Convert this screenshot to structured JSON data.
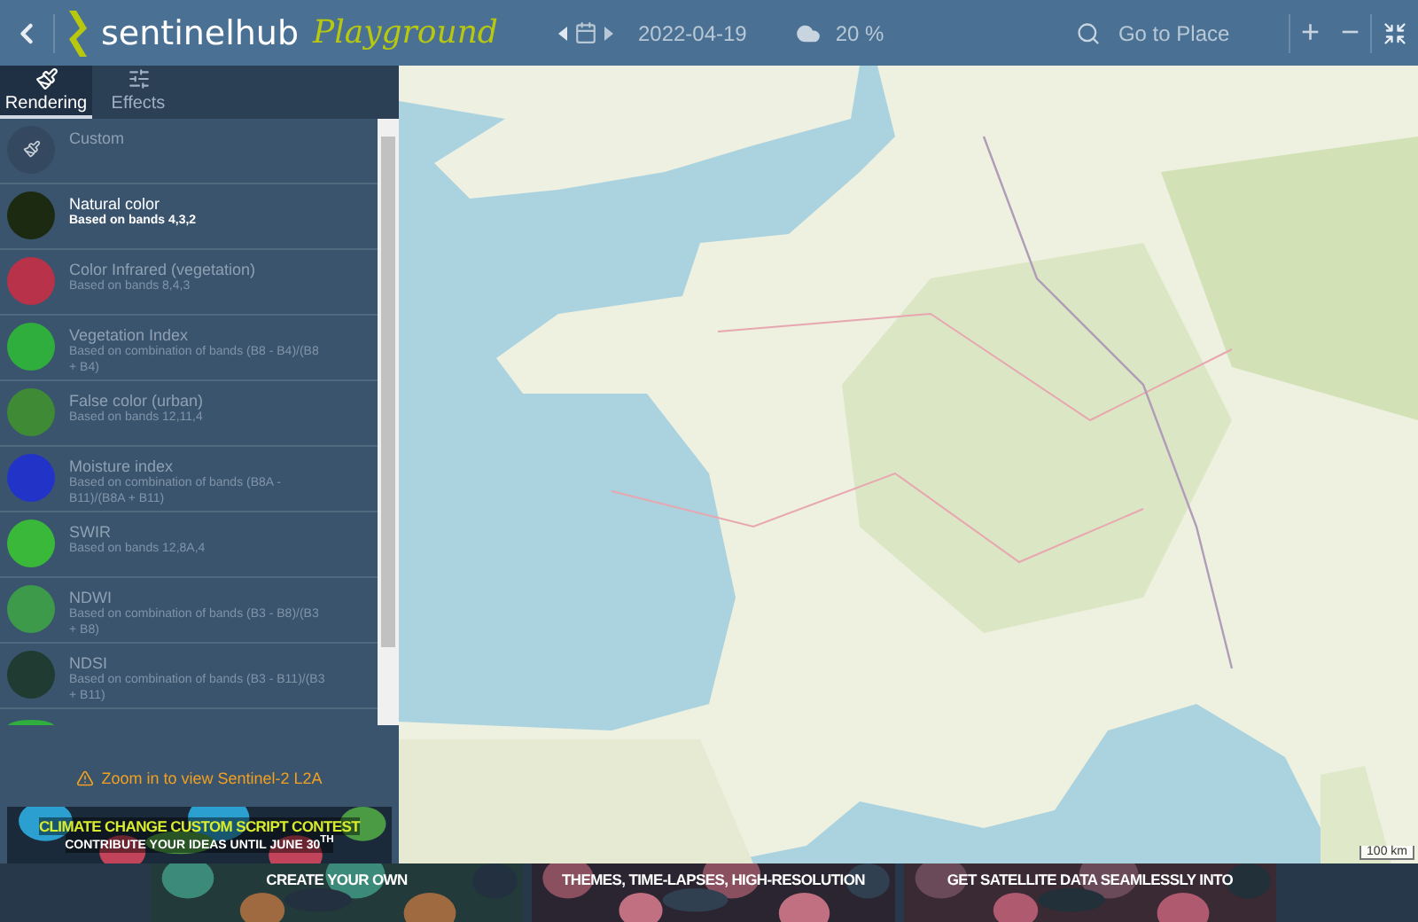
{
  "header": {
    "logo_name": "sentinelhub",
    "logo_product": "Playground",
    "date": "2022-04-19",
    "cloud_coverage": "20 %",
    "search": {
      "placeholder": "Go to Place"
    },
    "zoom_in": "+",
    "zoom_out": "−"
  },
  "tabs": [
    {
      "label": "Rendering",
      "selected": true,
      "kind": "brush"
    },
    {
      "label": "Effects",
      "selected": false,
      "kind": "sliders"
    }
  ],
  "layers": [
    {
      "title": "Custom",
      "kind": "custom",
      "selected": false
    },
    {
      "title": "Natural color",
      "subtitle": "Based on bands 4,3,2",
      "color": "#1d2a12",
      "selected": true
    },
    {
      "title": "Color Infrared (vegetation)",
      "subtitle": "Based on bands 8,4,3",
      "color": "#b8324a",
      "selected": false
    },
    {
      "title": "Vegetation Index",
      "subtitle": "Based on combination of bands (B8 - B4)/(B8 + B4)",
      "color": "#2fae3e",
      "selected": false
    },
    {
      "title": "False color (urban)",
      "subtitle": "Based on bands 12,11,4",
      "color": "#3f8a35",
      "selected": false
    },
    {
      "title": "Moisture index",
      "subtitle": "Based on combination of bands (B8A - B11)/(B8A + B11)",
      "color": "#2234c8",
      "selected": false
    },
    {
      "title": "SWIR",
      "subtitle": "Based on bands 12,8A,4",
      "color": "#39b83a",
      "selected": false
    },
    {
      "title": "NDWI",
      "subtitle": "Based on combination of bands (B3 - B8)/(B3 + B8)",
      "color": "#3c9a4a",
      "selected": false
    },
    {
      "title": "NDSI",
      "subtitle": "Based on combination of bands (B3 - B11)/(B3 + B11)",
      "color": "#1f3b32",
      "selected": false
    }
  ],
  "warning": "Zoom in to view Sentinel-2 L2A",
  "side_banner": {
    "line_1": "CLIMATE CHANGE CUSTOM SCRIPT CONTEST",
    "line_2": "CONTRIBUTE YOUR IDEAS UNTIL JUNE 30$^{TH}$"
  },
  "bottom_banners": [
    "CREATE YOUR OWN",
    "THEMES, TIME-LAPSES, HIGH-RESOLUTION",
    "GET SATELLITE DATA SEAMLESSLY INTO"
  ],
  "map": {
    "scale": "100 km"
  }
}
